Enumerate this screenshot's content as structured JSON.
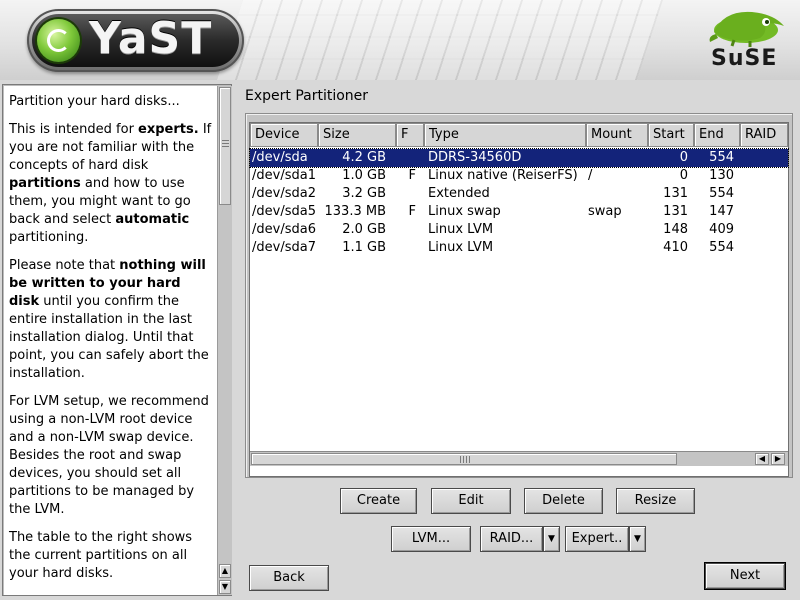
{
  "header": {
    "yast_logo_text": "YaST",
    "suse_logo_text": "SuSE"
  },
  "help": {
    "paragraphs": [
      [
        {
          "t": "Partition your hard disks..."
        }
      ],
      [
        {
          "t": "This is intended for "
        },
        {
          "t": "experts.",
          "b": true
        },
        {
          "t": " If you are not familiar with the concepts of hard disk "
        },
        {
          "t": "partitions",
          "b": true
        },
        {
          "t": " and how to use them, you might want to go back and select "
        },
        {
          "t": "automatic",
          "b": true
        },
        {
          "t": " partitioning."
        }
      ],
      [
        {
          "t": "Please note that "
        },
        {
          "t": "nothing will be written to your hard disk",
          "b": true
        },
        {
          "t": " until you confirm the entire installation in the last installation dialog. Until that point, you can safely abort the installation."
        }
      ],
      [
        {
          "t": "For LVM setup, we recommend using a non-LVM root device and a non-LVM swap device. Besides the root and swap devices, you should set all partitions to be managed by the LVM."
        }
      ],
      [
        {
          "t": "The table to the right shows the current partitions on all your hard disks."
        }
      ]
    ]
  },
  "main": {
    "title": "Expert Partitioner",
    "table": {
      "columns": [
        "Device",
        "Size",
        "F",
        "Type",
        "Mount",
        "Start",
        "End",
        "RAID"
      ],
      "rows": [
        {
          "device": "/dev/sda",
          "size": "4.2 GB",
          "f": "",
          "type": "DDRS-34560D",
          "mount": "",
          "start": "0",
          "end": "554",
          "raid": "",
          "selected": true
        },
        {
          "device": "/dev/sda1",
          "size": "1.0 GB",
          "f": "F",
          "type": "Linux native (ReiserFS)",
          "mount": "/",
          "start": "0",
          "end": "130",
          "raid": ""
        },
        {
          "device": "/dev/sda2",
          "size": "3.2 GB",
          "f": "",
          "type": "Extended",
          "mount": "",
          "start": "131",
          "end": "554",
          "raid": ""
        },
        {
          "device": "/dev/sda5",
          "size": "133.3 MB",
          "f": "F",
          "type": "Linux swap",
          "mount": "swap",
          "start": "131",
          "end": "147",
          "raid": ""
        },
        {
          "device": "/dev/sda6",
          "size": "2.0 GB",
          "f": "",
          "type": "Linux LVM",
          "mount": "",
          "start": "148",
          "end": "409",
          "raid": ""
        },
        {
          "device": "/dev/sda7",
          "size": "1.1 GB",
          "f": "",
          "type": "Linux LVM",
          "mount": "",
          "start": "410",
          "end": "554",
          "raid": ""
        }
      ]
    },
    "buttons": {
      "create": "Create",
      "edit": "Edit",
      "delete": "Delete",
      "resize": "Resize",
      "lvm": "LVM...",
      "raid": "RAID...",
      "expert": "Expert..",
      "back": "Back",
      "next": "Next"
    }
  },
  "colors": {
    "selection": "#13237a",
    "window_bg": "#d8d8d8",
    "suse_green": "#73ba25"
  },
  "icons": [
    "yast-logo-icon",
    "suse-chameleon-icon",
    "scroll-up-arrow-icon",
    "scroll-down-arrow-icon",
    "scroll-left-arrow-icon",
    "scroll-right-arrow-icon",
    "dropdown-arrow-icon"
  ]
}
